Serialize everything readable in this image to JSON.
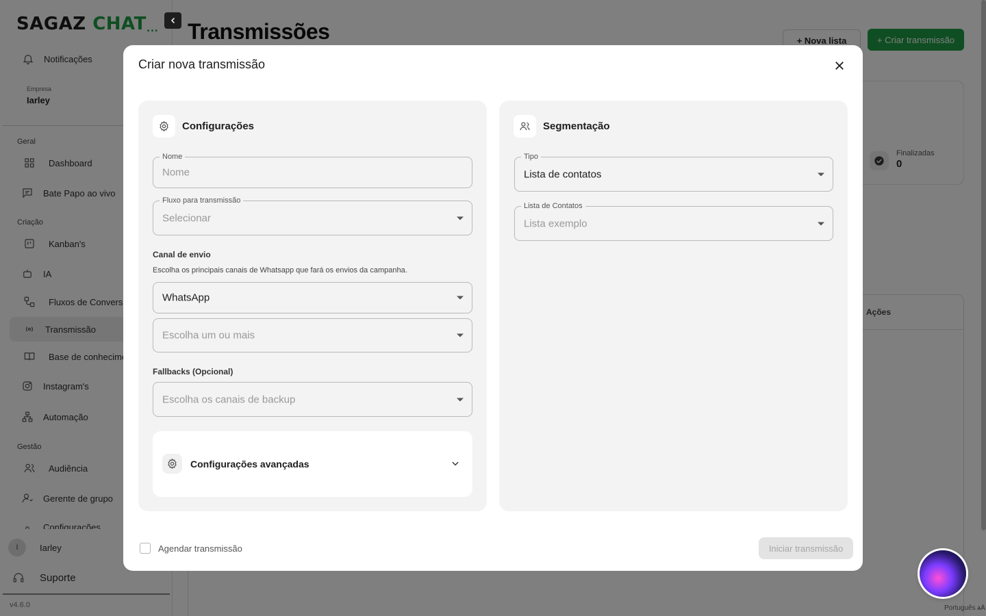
{
  "brand": {
    "name_part1": "SAGAZ ",
    "name_part2": "CHAT",
    "name_dots": "...",
    "accent_color": "#1f9d45"
  },
  "sidebar": {
    "notifications_label": "Notificações",
    "company_label": "Empresa",
    "company_name": "Iarley",
    "sections": {
      "geral": "Geral",
      "criacao": "Criação",
      "gestao": "Gestão"
    },
    "items": {
      "dashboard": "Dashboard",
      "bate_papo": "Bate Papo ao vivo",
      "kanbans": "Kanban's",
      "ia": "IA",
      "fluxos": "Fluxos de Conversa",
      "transmissao": "Transmissão",
      "base": "Base de conhecimento",
      "instagrams": "Instagram's",
      "automacao": "Automação",
      "audiencia": "Audiência",
      "gerente_grupo": "Gerente de grupo",
      "configuracoes": "Configurações"
    },
    "user_initial": "I",
    "user_name": "Iarley",
    "support_label": "Suporte",
    "version": "v4.6.0"
  },
  "page": {
    "title": "Transmissões",
    "nova_lista_button": "+ Nova lista",
    "criar_transmissao_button": "+ Criar transmissão",
    "stat_finalizadas_label": "Finalizadas",
    "stat_finalizadas_value": "0",
    "table_col_acoes": "Ações",
    "language": "Português"
  },
  "modal": {
    "title": "Criar nova transmissão",
    "config_panel": {
      "title": "Configurações",
      "nome_label": "Nome",
      "nome_placeholder": "Nome",
      "fluxo_label": "Fluxo para transmissão",
      "fluxo_placeholder": "Selecionar",
      "canal_title": "Canal de envio",
      "canal_desc": "Escolha os principais canais de Whatsapp que fará os envios da campanha.",
      "canal_value": "WhatsApp",
      "canal_multi_placeholder": "Escolha um ou mais",
      "fallbacks_title": "Fallbacks (Opcional)",
      "fallbacks_placeholder": "Escolha os canais de backup",
      "advanced_title": "Configurações avançadas"
    },
    "segment_panel": {
      "title": "Segmentação",
      "tipo_label": "Tipo",
      "tipo_value": "Lista de contatos",
      "lista_label": "Lista de Contatos",
      "lista_placeholder": "Lista exemplo"
    },
    "schedule_label": "Agendar transmissão",
    "start_button": "Iniciar transmissão"
  }
}
